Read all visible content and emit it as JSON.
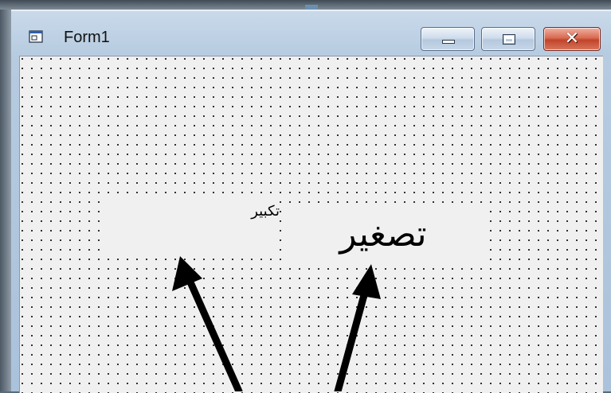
{
  "window": {
    "title": "Form1",
    "icon": "form-icon",
    "caption_buttons": [
      "minimize-icon",
      "maximize-icon",
      "close-icon"
    ],
    "close_glyph": "✕"
  },
  "form": {
    "labels": [
      {
        "text": "تكبير"
      },
      {
        "text": "تصغير"
      }
    ]
  },
  "annotations": {
    "arrows": [
      "arrow-to-small-label",
      "arrow-to-large-label"
    ],
    "arrow_color": "#000000"
  },
  "colors": {
    "surface": "#f0f0f0",
    "grid_dots": "#000000",
    "close_button": "#c1432a"
  }
}
